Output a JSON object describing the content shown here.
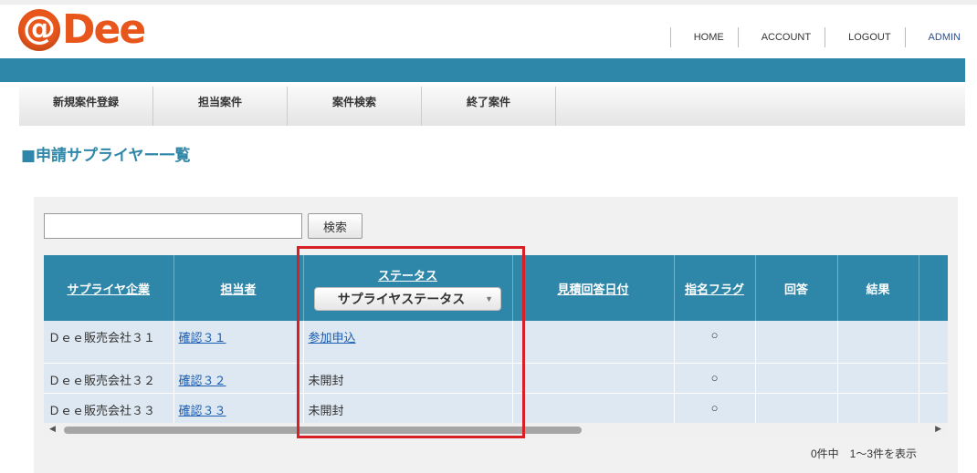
{
  "header": {
    "logo_at": "@",
    "logo_text": "Dee",
    "nav": [
      "HOME",
      "ACCOUNT",
      "LOGOUT",
      "ADMIN"
    ]
  },
  "menu": [
    "新規案件登録",
    "担当案件",
    "案件検索",
    "終了案件"
  ],
  "page_title": "■申請サプライヤー一覧",
  "search": {
    "value": "",
    "placeholder": "",
    "button_label": "検索"
  },
  "table": {
    "headers": {
      "supplier": "サプライヤ企業",
      "person": "担当者",
      "status": "ステータス",
      "status_filter": "サプライヤステータス",
      "quote_date": "見積回答日付",
      "nominate_flag": "指名フラグ",
      "answer": "回答",
      "result": "結果"
    },
    "rows": [
      {
        "supplier": "Ｄｅｅ販売会社３１",
        "person": "確認３１",
        "status": "参加申込",
        "quote_date": "",
        "flag": "○",
        "answer": "",
        "result": ""
      },
      {
        "supplier": "Ｄｅｅ販売会社３２",
        "person": "確認３２",
        "status": "未開封",
        "quote_date": "",
        "flag": "○",
        "answer": "",
        "result": ""
      },
      {
        "supplier": "Ｄｅｅ販売会社３３",
        "person": "確認３３",
        "status": "未開封",
        "quote_date": "",
        "flag": "○",
        "answer": "",
        "result": ""
      }
    ]
  },
  "paging": "0件中　1～3件を表示",
  "colors": {
    "accent": "#2e87a8",
    "logo": "#e8561b",
    "highlight": "#d91f26",
    "row_bg": "#dde8f2"
  }
}
